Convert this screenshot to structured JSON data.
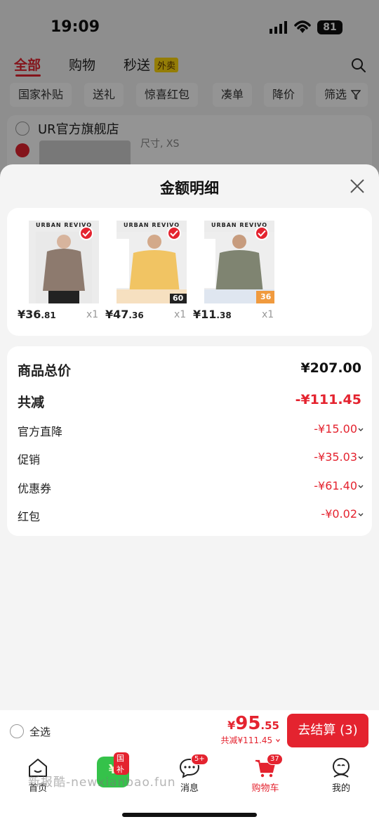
{
  "status_bar": {
    "time": "19:09",
    "battery": "81"
  },
  "top_tabs": [
    {
      "label": "全部"
    },
    {
      "label": "购物"
    },
    {
      "label": "秒送"
    }
  ],
  "waimai_tag": "外卖",
  "filter_chips": [
    {
      "label": "国家补贴"
    },
    {
      "label": "送礼"
    },
    {
      "label": "惊喜红包"
    },
    {
      "label": "凑单"
    },
    {
      "label": "降价"
    },
    {
      "label": "筛选"
    }
  ],
  "store": {
    "name": "UR官方旗舰店",
    "spec": "尺寸, XS"
  },
  "sheet": {
    "title": "金额明细",
    "items": [
      {
        "brand": "URBAN REVIVO",
        "price_int": "¥36",
        "price_dec": ".81",
        "qty": "x1",
        "color": "#8d7a6e"
      },
      {
        "brand": "URBAN REVIVO",
        "price_int": "¥47",
        "price_dec": ".36",
        "qty": "x1",
        "color": "#f1c463",
        "tag": "60"
      },
      {
        "brand": "URBAN REVIVO",
        "price_int": "¥11",
        "price_dec": ".38",
        "qty": "x1",
        "color": "#7f8471",
        "tag": "36"
      }
    ],
    "summary": {
      "total_label": "商品总价",
      "total_value": "¥207.00",
      "reduce_label": "共减",
      "reduce_value": "-¥111.45",
      "lines": [
        {
          "label": "官方直降",
          "value": "-¥15.00"
        },
        {
          "label": "促销",
          "value": "-¥35.03"
        },
        {
          "label": "优惠券",
          "value": "-¥61.40"
        },
        {
          "label": "红包",
          "value": "-¥0.02"
        }
      ]
    }
  },
  "checkout": {
    "select_all": "全选",
    "yen": "¥",
    "price_int": "95",
    "price_dec": ".55",
    "saving": "共减¥111.45",
    "pay_button": "去结算 (3)"
  },
  "tabbar": {
    "items": [
      {
        "label": "首页"
      },
      {
        "label": ""
      },
      {
        "label": "消息",
        "badge": "5+"
      },
      {
        "label": "购物车",
        "badge": "37"
      },
      {
        "label": "我的"
      }
    ],
    "subsidy_badge": "国补",
    "subsidy_icon": "¥"
  },
  "watermark": "新报酷-newxianbao.fun",
  "colors": {
    "accent": "#e4232f",
    "subsidy_green": "#35c24a",
    "waimai_yellow": "#ffd80d"
  },
  "icons": [
    "search-icon",
    "filter-icon",
    "close-icon",
    "checkmark-icon",
    "chevron-down-icon",
    "home-icon",
    "chat-icon",
    "cart-icon",
    "profile-icon",
    "wifi-icon",
    "signal-icon"
  ]
}
